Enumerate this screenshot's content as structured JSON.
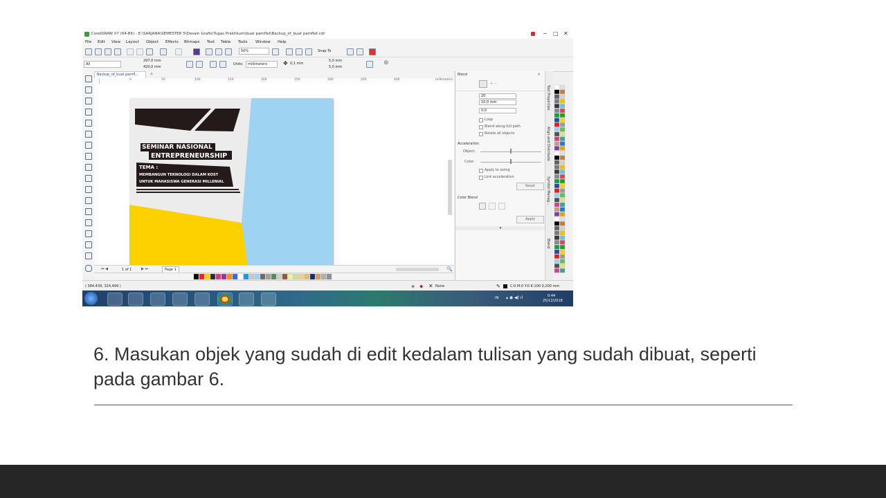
{
  "app": {
    "title": "CorelDRAW X7 (64-Bit) - E:\\SARJANA\\SEMESTER 5\\Desain Grafis\\Tugas Praktikum\\buat pamflet\\Backup_of_buat pamflet.cdr",
    "window_controls": [
      "─",
      "□",
      "✕"
    ]
  },
  "menu": [
    "File",
    "Edit",
    "View",
    "Layout",
    "Object",
    "Effects",
    "Bitmaps",
    "Text",
    "Table",
    "Tools",
    "Window",
    "Help"
  ],
  "toolbar": {
    "zoom": "50%",
    "snap_to": "Snap To"
  },
  "property_bar": {
    "preset": "All",
    "width": "297,0 mm",
    "height": "420,0 mm",
    "units_label": "Units:",
    "units_value": "millimeters",
    "nudge": "0,1 mm",
    "dup_x": "5,0 mm",
    "dup_y": "5,0 mm"
  },
  "document": {
    "tab": "Backup_of_buat pamfl...",
    "ruler_numbers": [
      "0",
      "50",
      "100",
      "150",
      "200",
      "250",
      "300",
      "350",
      "400"
    ],
    "ruler_unit": "millimeters"
  },
  "design": {
    "banner_line1": "SEMINAR NASIONAL",
    "banner_line2": "ENTREPRENEURSHIP",
    "tema": "TEMA :",
    "theme_line1": "MEMBANGUN TEKNOLOGI DALAM KOST",
    "theme_line2": "UNTUK MAHASISWA GENERASI MILLENIAL",
    "colors": {
      "page_bg": "#ececec",
      "dark_shape": "#241a1a",
      "light_blue": "#9ed4f2",
      "yellow": "#fdd000"
    }
  },
  "page_nav": {
    "page_count": "1 of 1",
    "page_tab": "Page 1"
  },
  "status": {
    "coordinates": "( 384,439; 324,499 )",
    "fill": "None",
    "outline": "C:0 M:0 Y:0 K:100  0,200 mm"
  },
  "docker": {
    "title": "Blend",
    "steps": "20",
    "spacing": "10,0 mm",
    "rotation": "0,0",
    "loop": "Loop",
    "blend_along_full_path": "Blend along full path",
    "rotate_all_objects": "Rotate all objects",
    "acceleration": "Acceleration",
    "object": "Object:",
    "color": "Color:",
    "apply_to_sizing": "Apply to sizing",
    "link_acceleration": "Link acceleration",
    "reset": "Reset",
    "color_blend": "Color Blend",
    "apply": "Apply",
    "vertical_tabs": [
      "Tool Properties",
      "Align and Distribute",
      "Symbol Manag...",
      "Blend"
    ]
  },
  "taskbar": {
    "lang": "IN",
    "time": "0:44",
    "date": "25/12/2018"
  },
  "slide": {
    "caption": "6. Masukan objek yang sudah di edit kedalam tulisan yang sudah dibuat, seperti pada gambar 6."
  }
}
